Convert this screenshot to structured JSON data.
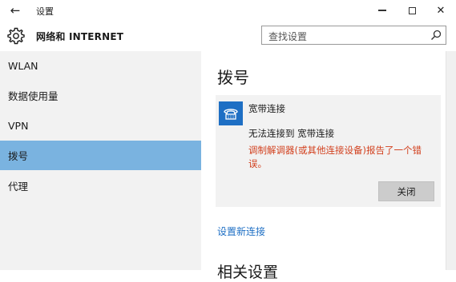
{
  "window": {
    "title": "设置",
    "back_glyph": "←",
    "min_label": "",
    "close_glyph": "✕"
  },
  "header": {
    "app_title": "网络和 INTERNET",
    "search_placeholder": "查找设置"
  },
  "sidebar": {
    "items": [
      {
        "label": "WLAN",
        "selected": false
      },
      {
        "label": "数据使用量",
        "selected": false
      },
      {
        "label": "VPN",
        "selected": false
      },
      {
        "label": "拨号",
        "selected": true
      },
      {
        "label": "代理",
        "selected": false
      }
    ]
  },
  "main": {
    "page_title": "拨号",
    "connection": {
      "name": "宽带连接",
      "status": "无法连接到 宽带连接",
      "error": "调制解调器(或其他连接设备)报告了一个错误。",
      "close_label": "关闭"
    },
    "setup_link": "设置新连接",
    "related_heading": "相关设置"
  },
  "colors": {
    "accent": "#1e6fc4",
    "selected_bg": "#7ab3e0",
    "error": "#d2401e",
    "sidebar_bg": "#f2f2f2"
  },
  "icons": {
    "back": "arrow-left-icon",
    "settings": "gear-icon",
    "search": "search-icon",
    "connection": "dialup-phone-icon"
  }
}
